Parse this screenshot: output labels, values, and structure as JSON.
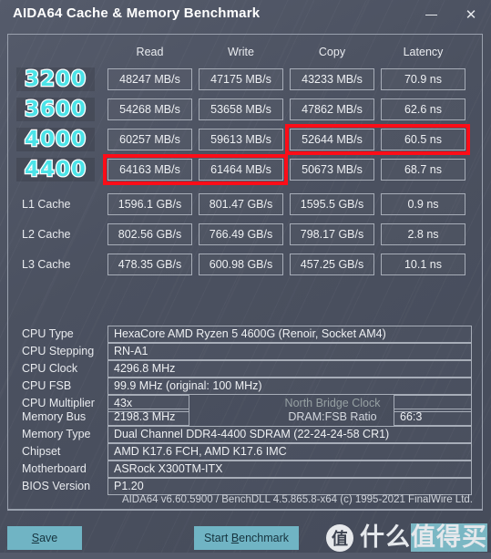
{
  "window": {
    "title": "AIDA64 Cache & Memory Benchmark",
    "minimize_label": "minimize",
    "close_label": "✕"
  },
  "table": {
    "columns": [
      "Read",
      "Write",
      "Copy",
      "Latency"
    ],
    "rows": [
      {
        "label": "3200",
        "overlay": true,
        "values": [
          "48247 MB/s",
          "47175 MB/s",
          "43233 MB/s",
          "70.9 ns"
        ]
      },
      {
        "label": "3600",
        "overlay": true,
        "values": [
          "54268 MB/s",
          "53658 MB/s",
          "47862 MB/s",
          "62.6 ns"
        ]
      },
      {
        "label": "4000",
        "overlay": true,
        "values": [
          "60257 MB/s",
          "59613 MB/s",
          "52644 MB/s",
          "60.5 ns"
        ]
      },
      {
        "label": "4400",
        "overlay": true,
        "values": [
          "64163 MB/s",
          "61464 MB/s",
          "50673 MB/s",
          "68.7 ns"
        ]
      },
      {
        "label": "L1 Cache",
        "overlay": false,
        "values": [
          "1596.1 GB/s",
          "801.47 GB/s",
          "1595.5 GB/s",
          "0.9 ns"
        ]
      },
      {
        "label": "L2 Cache",
        "overlay": false,
        "values": [
          "802.56 GB/s",
          "766.49 GB/s",
          "798.17 GB/s",
          "2.8 ns"
        ]
      },
      {
        "label": "L3 Cache",
        "overlay": false,
        "values": [
          "478.35 GB/s",
          "600.98 GB/s",
          "457.25 GB/s",
          "10.1 ns"
        ]
      }
    ]
  },
  "annotations": {
    "color": "#fd0d18",
    "boxes": [
      {
        "name": "highlight-4000-copy-latency",
        "row": "4000",
        "columns": [
          "Copy",
          "Latency"
        ]
      },
      {
        "name": "highlight-4400-read-write",
        "row": "4400",
        "columns": [
          "Read",
          "Write"
        ]
      }
    ]
  },
  "cpu": {
    "type_label": "CPU Type",
    "type_value": "HexaCore AMD Ryzen 5 4600G  (Renoir, Socket AM4)",
    "stepping_label": "CPU Stepping",
    "stepping_value": "RN-A1",
    "clock_label": "CPU Clock",
    "clock_value": "4296.8 MHz",
    "fsb_label": "CPU FSB",
    "fsb_value": "99.9 MHz  (original: 100 MHz)",
    "multiplier_label": "CPU Multiplier",
    "multiplier_value": "43x",
    "north_bridge_label": "North Bridge Clock",
    "north_bridge_value": ""
  },
  "memory": {
    "bus_label": "Memory Bus",
    "bus_value": "2198.3 MHz",
    "ratio_label": "DRAM:FSB Ratio",
    "ratio_value": "66:3",
    "type_label": "Memory Type",
    "type_value": "Dual Channel DDR4-4400 SDRAM  (22-24-24-58 CR1)",
    "chipset_label": "Chipset",
    "chipset_value": "AMD K17.6 FCH, AMD K17.6 IMC",
    "motherboard_label": "Motherboard",
    "motherboard_value": "ASRock X300TM-ITX",
    "bios_label": "BIOS Version",
    "bios_value": "P1.20"
  },
  "footer": {
    "credit": "AIDA64 v6.60.5900 / BenchDLL 4.5.865.8-x64  (c) 1995-2021 FinalWire Ltd.",
    "save_label_pre": "S",
    "save_label_post": "ave",
    "benchmark_label_pre": "Start ",
    "benchmark_label_mid": "B",
    "benchmark_label_post": "enchmark",
    "button_color": "#70b4c4"
  },
  "watermark": {
    "badge": "值",
    "text_plain": "什么",
    "text_highlighted": "值得买"
  }
}
